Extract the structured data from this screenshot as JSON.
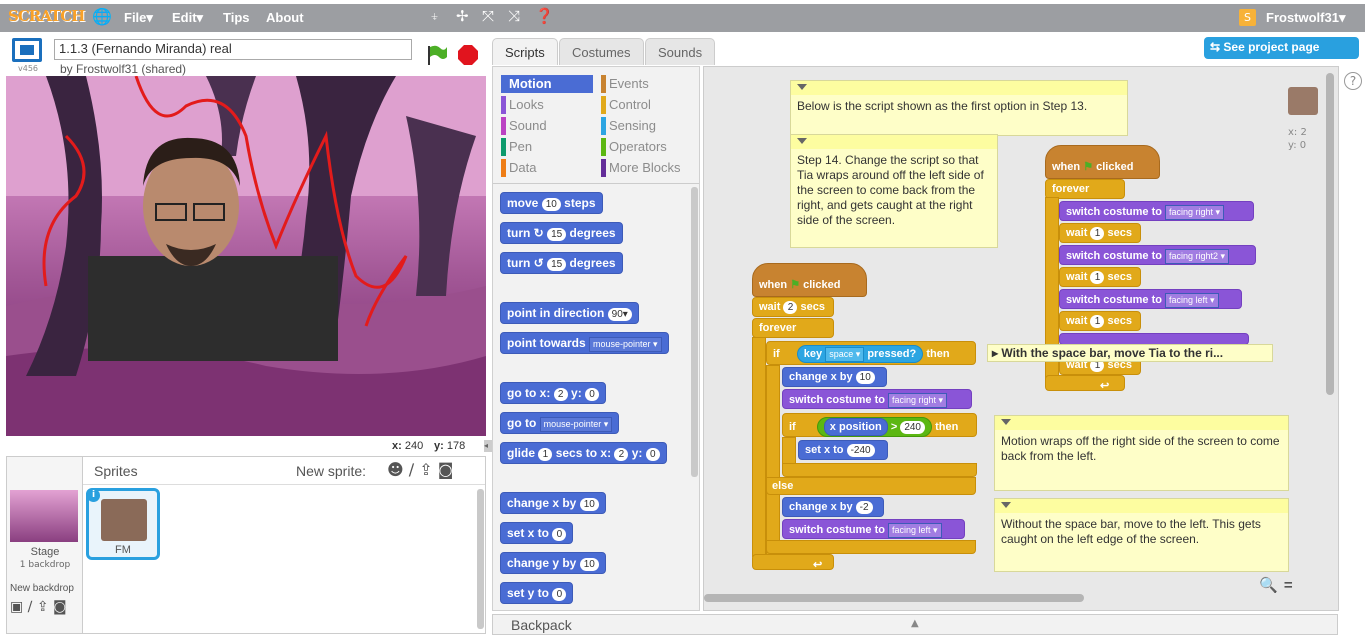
{
  "topbar": {
    "logo": "SCRATCH",
    "menu": [
      "File▾",
      "Edit▾",
      "Tips",
      "About"
    ],
    "user": "Frostwolf31▾"
  },
  "stage_header": {
    "version": "v456",
    "title": "1.1.3 (Fernando Miranda) real",
    "byline": "by Frostwolf31 (shared)"
  },
  "stage_coords": {
    "x_label": "x:",
    "x_val": "240",
    "y_label": "y:",
    "y_val": "178"
  },
  "sprites": {
    "header": "Sprites",
    "new_sprite": "New sprite:",
    "stage_label": "Stage",
    "backdrop_count": "1 backdrop",
    "new_backdrop": "New backdrop",
    "sprite_name": "FM"
  },
  "tabs": [
    "Scripts",
    "Costumes",
    "Sounds"
  ],
  "see_project": "Se​e project page",
  "categories": [
    {
      "label": "Motion",
      "color": "#4a6cd4"
    },
    {
      "label": "Events",
      "color": "#c88330"
    },
    {
      "label": "Looks",
      "color": "#8a55d7"
    },
    {
      "label": "Control",
      "color": "#e1a91a"
    },
    {
      "label": "Sound",
      "color": "#bb42c3"
    },
    {
      "label": "Sensing",
      "color": "#2ca5e2"
    },
    {
      "label": "Pen",
      "color": "#0e9a6c"
    },
    {
      "label": "Operators",
      "color": "#5cb712"
    },
    {
      "label": "Data",
      "color": "#ee7d16"
    },
    {
      "label": "More Blocks",
      "color": "#632d99"
    }
  ],
  "palette": {
    "move": "move",
    "move_n": "10",
    "steps": "steps",
    "turn": "turn",
    "turn_cw_n": "15",
    "degrees": "degrees",
    "turn_ccw_n": "15",
    "point_dir": "point in direction",
    "dir_n": "90▾",
    "point_towards": "point towards",
    "mouse_pointer": "mouse-pointer ▾",
    "goto_xy": "go to x:",
    "gx": "2",
    "y_colon": "y:",
    "gy": "0",
    "goto": "go to",
    "glide": "glide",
    "glide_n": "1",
    "secs_to_x": "secs to x:",
    "glx": "2",
    "gly": "0",
    "change_x": "change x by",
    "cx": "10",
    "set_x": "set x to",
    "sx": "0",
    "change_y": "change y by",
    "cy": "10",
    "set_y": "set y to",
    "sy": "0"
  },
  "sprite_info": {
    "x": "x: 2",
    "y": "y: 0"
  },
  "notes": {
    "n1": "Below is the script shown as the first option in Step 13.",
    "n2": "Step 14. Change the script so that Tia wraps around off the left side of the screen to come back from the right, and gets caught at the right side of the screen.",
    "n3": "Motion wraps off the right side of the screen to come back from the left.",
    "n4": "Without the space bar, move to the left. This gets caught on the left edge of the screen.",
    "collapsed": "With the space bar, move Tia to the ri..."
  },
  "script1": {
    "when": "when",
    "clicked": "clicked",
    "wait": "wait",
    "wait_n": "2",
    "secs": "secs",
    "forever": "forever",
    "if": "if",
    "key": "key",
    "space": "space ▾",
    "pressed": "pressed?",
    "then": "then",
    "change_x": "change x by",
    "cx1": "10",
    "switch_costume": "switch costume to",
    "facing_right": "facing right ▾",
    "x_position": "x position",
    "gt": ">",
    "val240": "240",
    "set_x": "set x to",
    "sx": "-240",
    "else": "else",
    "cx2": "-2",
    "facing_left": "facing left ▾"
  },
  "script2": {
    "when": "when",
    "clicked": "clicked",
    "forever": "forever",
    "switch": "switch costume to",
    "wait": "wait",
    "one": "1",
    "secs": "secs",
    "c1": "facing right ▾",
    "c2": "facing right2 ▾",
    "c3": "facing left ▾",
    "c4": "facing left2 ▾"
  },
  "backpack": "Backpack",
  "zoom": [
    "−",
    "=",
    "+"
  ]
}
